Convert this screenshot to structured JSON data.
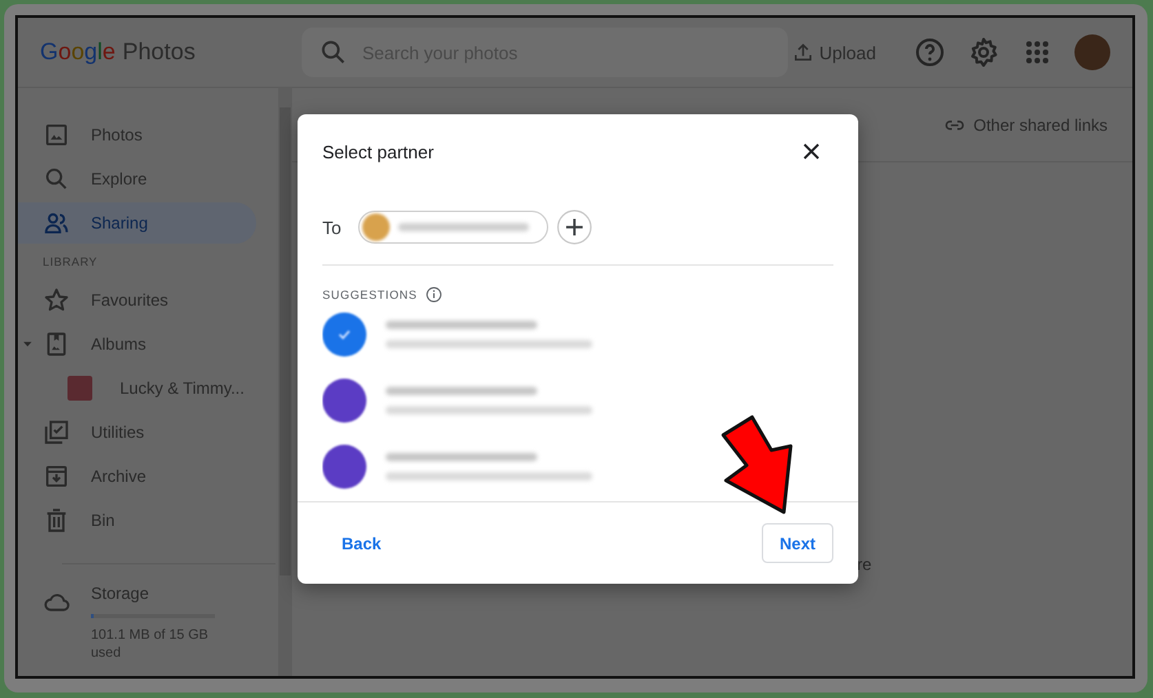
{
  "header": {
    "logo": "Google",
    "app_name": "Photos",
    "search": {
      "placeholder": "Search your photos"
    },
    "upload": "Upload"
  },
  "sidebar": {
    "items": [
      {
        "kind": "item",
        "label": "Photos",
        "selected": false
      },
      {
        "kind": "item",
        "label": "Explore",
        "selected": false
      },
      {
        "kind": "item",
        "label": "Sharing",
        "selected": true
      },
      {
        "kind": "heading",
        "label": "LIBRARY"
      },
      {
        "kind": "item",
        "label": "Favourites",
        "selected": false
      },
      {
        "kind": "item",
        "label": "Albums",
        "selected": false,
        "expanded": true,
        "children": [
          {
            "kind": "album",
            "label": "Lucky & Timmy...",
            "selected": false
          }
        ]
      },
      {
        "kind": "item",
        "label": "Utilities",
        "selected": false
      },
      {
        "kind": "item",
        "label": "Archive",
        "selected": false
      },
      {
        "kind": "item",
        "label": "Bin",
        "selected": false
      }
    ],
    "storage": {
      "label": "Storage",
      "level": 0.02,
      "reading": "101.1 MB of 15 GB used"
    }
  },
  "main": {
    "link": "Other shared links",
    "fragment": "re"
  },
  "dialog": {
    "title": "Select partner",
    "to_label": "To",
    "suggestions_label": "SUGGESTIONS",
    "suggestions": [
      {
        "color": "#1a73e8",
        "selected": true
      },
      {
        "color": "#5b3cc4",
        "selected": false
      },
      {
        "color": "#5b3cc4",
        "selected": false
      }
    ],
    "buttons": [
      {
        "kind": "text",
        "label": "Back"
      },
      {
        "kind": "outlined",
        "label": "Next"
      }
    ]
  }
}
